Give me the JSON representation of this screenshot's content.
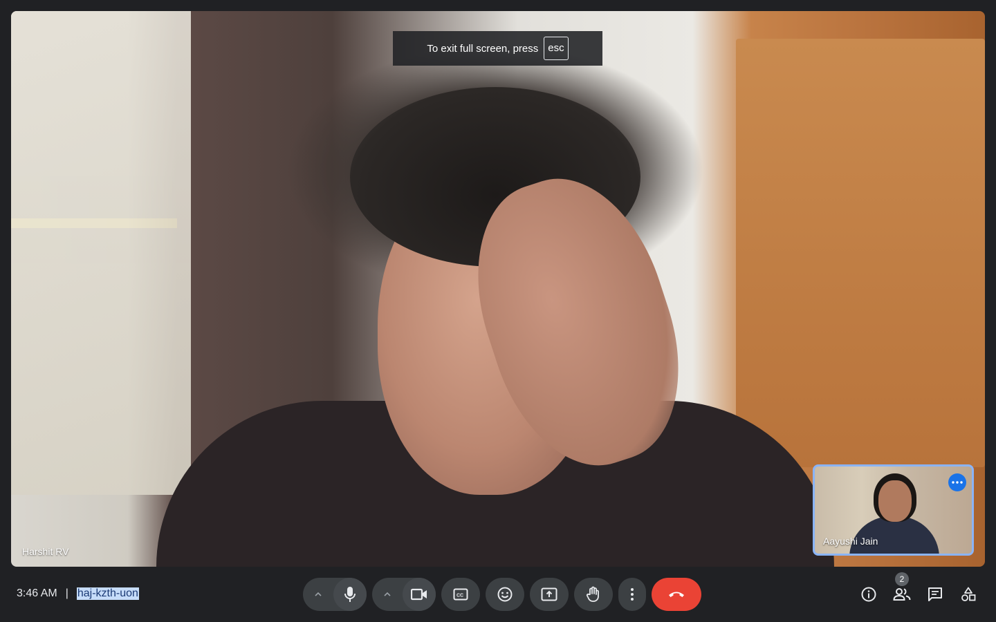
{
  "fullscreen_toast": {
    "text": "To exit full screen, press",
    "key": "esc"
  },
  "main_tile": {
    "participant_name": "Harshit RV"
  },
  "pip_tile": {
    "participant_name": "Aayushi Jain",
    "more_icon": "more-options-icon"
  },
  "meeting": {
    "time": "3:46 AM",
    "separator": "|",
    "code": "haj-kzth-uon"
  },
  "controls": {
    "mic": {
      "icon": "mic-icon",
      "arrow": "chevron-up-icon"
    },
    "camera": {
      "icon": "videocam-icon",
      "arrow": "chevron-up-icon"
    },
    "captions": {
      "icon": "closed-captions-icon"
    },
    "reactions": {
      "icon": "emoji-icon"
    },
    "present": {
      "icon": "present-screen-icon"
    },
    "raise_hand": {
      "icon": "hand-icon"
    },
    "more": {
      "icon": "more-vert-icon"
    },
    "end_call": {
      "icon": "call-end-icon",
      "color": "#ea4335"
    }
  },
  "right_panel": {
    "info_icon": "info-icon",
    "people_icon": "people-icon",
    "people_count": "2",
    "chat_icon": "chat-icon",
    "activities_icon": "activities-icon"
  },
  "colors": {
    "background": "#202124",
    "control": "#3c4043",
    "accent": "#8ab4f8",
    "end_call": "#ea4335"
  }
}
